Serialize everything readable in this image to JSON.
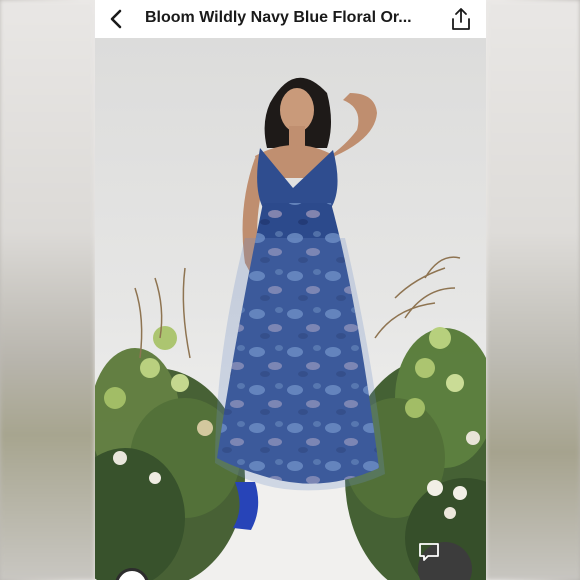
{
  "header": {
    "title": "Bloom Wildly Navy Blue Floral Or...",
    "back_icon": "chevron-left-icon",
    "share_icon": "share-icon"
  },
  "photo": {
    "subject": "model in navy blue floral organza maxi dress with plants",
    "dress_color": "#2c4a8c"
  },
  "actions": {
    "chat_icon": "comment-icon"
  }
}
